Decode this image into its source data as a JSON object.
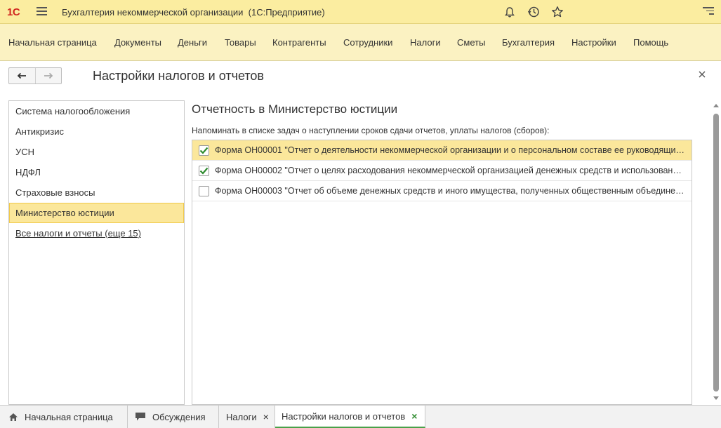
{
  "titlebar": {
    "logo": "1С",
    "app_title": "Бухгалтерия некоммерческой организации",
    "platform": "(1С:Предприятие)"
  },
  "sections": [
    "Начальная страница",
    "Документы",
    "Деньги",
    "Товары",
    "Контрагенты",
    "Сотрудники",
    "Налоги",
    "Сметы",
    "Бухгалтерия",
    "Настройки",
    "Помощь"
  ],
  "form": {
    "title": "Настройки налогов и отчетов"
  },
  "left_nav": {
    "items": [
      "Система налогообложения",
      "Антикризис",
      "УСН",
      "НДФЛ",
      "Страховые взносы",
      "Министерство юстиции"
    ],
    "active_index": 5,
    "all_link": "Все налоги и отчеты (еще 15)"
  },
  "content": {
    "group_title": "Отчетность в Министерство юстиции",
    "hint": "Напоминать в списке задач о наступлении сроков сдачи отчетов, уплаты налогов (сборов):",
    "rows": [
      {
        "checked": true,
        "text": "Форма ОН00001 \"Отчет о деятельности некоммерческой организации и о персональном составе ее руководящих органов\""
      },
      {
        "checked": true,
        "text": "Форма ОН00002 \"Отчет о целях расходования некоммерческой организацией денежных средств и использования иного имущества\""
      },
      {
        "checked": false,
        "text": "Форма ОН00003 \"Отчет об объеме денежных средств и иного имущества, полученных общественным объединением\""
      }
    ]
  },
  "tabs": {
    "home": "Начальная страница",
    "discussions": "Обсуждения",
    "taxes": "Налоги",
    "settings": "Настройки налогов и отчетов",
    "close_symbol": "×"
  },
  "colors": {
    "titlebar_bg": "#fbeda0",
    "sections_bg": "#fbf2c2",
    "selection": "#fbe79b",
    "checkbox_green": "#2e8b2e",
    "logo_red": "#d0261f"
  }
}
